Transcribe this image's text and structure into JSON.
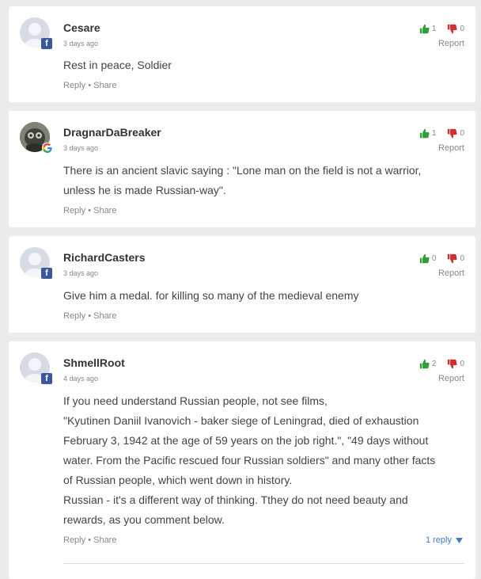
{
  "comments": [
    {
      "author": "Cesare",
      "time": "3 days ago",
      "source": "facebook",
      "up": "1",
      "down": "0",
      "report": "Report",
      "body": [
        "Rest in peace, Soldier"
      ],
      "reply": "Reply",
      "sep": "•",
      "share": "Share"
    },
    {
      "author": "DragnarDaBreaker",
      "time": "3 days ago",
      "source": "google",
      "up": "1",
      "down": "0",
      "report": "Report",
      "body": [
        "There is an ancient slavic saying : \"Lone man on the field is not a warrior,",
        "unless he is made Russian-way\"."
      ],
      "reply": "Reply",
      "sep": "•",
      "share": "Share"
    },
    {
      "author": "RichardCasters",
      "time": "3 days ago",
      "source": "facebook",
      "up": "0",
      "down": "0",
      "report": "Report",
      "body": [
        "Give him a medal. for killing so many of the medieval enemy"
      ],
      "reply": "Reply",
      "sep": "•",
      "share": "Share"
    },
    {
      "author": "ShmellRoot",
      "time": "4 days ago",
      "source": "facebook",
      "up": "2",
      "down": "0",
      "report": "Report",
      "body": [
        "If you need understand Russian people, not see films,",
        "\"Kyutinen Daniil Ivanovich - baker siege of Leningrad, died of exhaustion",
        "February 3, 1942 at the age of 59 years on the job right.\", \"49 days without",
        "water. From the Pacific rescued four Russian soldiers\" and many other facts",
        "of Russian people, which went down in history.",
        "Russian - it's a different way of thinking. Tthey do not need beauty and",
        "rewards, as you comment below."
      ],
      "reply": "Reply",
      "sep": "•",
      "share": "Share",
      "replies": "1 reply"
    }
  ],
  "icons": {
    "thumb_up": "thumb-up-icon",
    "thumb_down": "thumb-down-icon",
    "facebook": "facebook-icon",
    "google": "google-icon",
    "caret": "chevron-down-icon"
  },
  "colors": {
    "upvote": "#2e9e3a",
    "downvote": "#d12e2e",
    "link": "#3d7cc9",
    "facebook": "#3b5998"
  }
}
